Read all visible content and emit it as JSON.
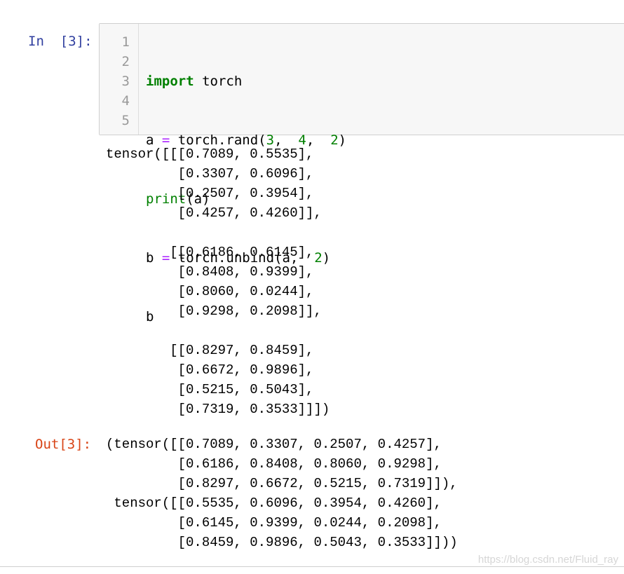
{
  "cell": {
    "in_prompt": "In  [3]:",
    "out_prompt": "Out[3]:",
    "line_numbers": "1\n2\n3\n4\n5",
    "code": {
      "l1_kw": "import",
      "l1_rest": " torch",
      "l2_a": "a ",
      "l2_eq": "=",
      "l2_call": " torch.rand(",
      "l2_n1": "3",
      "l2_c1": ",  ",
      "l2_n2": "4",
      "l2_c2": ",  ",
      "l2_n3": "2",
      "l2_end": ")",
      "l3_fn": "print",
      "l3_rest": "(a)",
      "l4_b": "b ",
      "l4_eq": "=",
      "l4_call": " torch.unbind(a,  ",
      "l4_n": "2",
      "l4_end": ")",
      "l5": "b"
    },
    "stdout": "tensor([[[0.7089, 0.5535],\n         [0.3307, 0.6096],\n         [0.2507, 0.3954],\n         [0.4257, 0.4260]],\n\n        [[0.6186, 0.6145],\n         [0.8408, 0.9399],\n         [0.8060, 0.0244],\n         [0.9298, 0.2098]],\n\n        [[0.8297, 0.8459],\n         [0.6672, 0.9896],\n         [0.5215, 0.5043],\n         [0.7319, 0.3533]]])",
    "result": "(tensor([[0.7089, 0.3307, 0.2507, 0.4257],\n         [0.6186, 0.8408, 0.8060, 0.9298],\n         [0.8297, 0.6672, 0.5215, 0.7319]]),\n tensor([[0.5535, 0.6096, 0.3954, 0.4260],\n         [0.6145, 0.9399, 0.0244, 0.2098],\n         [0.8459, 0.9896, 0.5043, 0.3533]]))"
  },
  "watermark": "https://blog.csdn.net/Fluid_ray",
  "colors": {
    "in_prompt": "#303f9f",
    "out_prompt": "#d84315",
    "keyword": "#008000",
    "operator": "#aa22ff",
    "input_background": "#f7f7f7"
  }
}
